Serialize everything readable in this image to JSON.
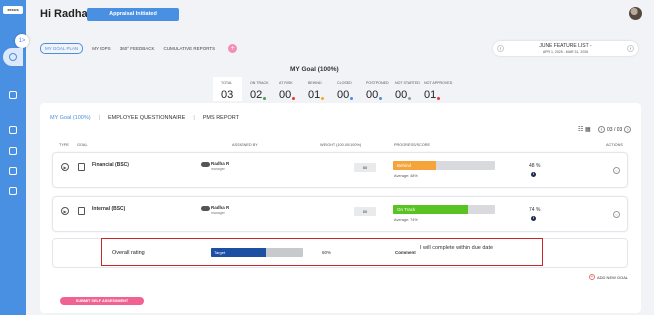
{
  "sidebar": {
    "logo": "xecus",
    "toggle": "1>"
  },
  "header": {
    "greeting": "Hi Radha R",
    "appraisal_button": "Appraisal Initiated"
  },
  "tabs": [
    "MY GOAL PLAN",
    "MY IDPS",
    "360° FEEDBACK",
    "CUMULATIVE REPORTS"
  ],
  "add_label": "+",
  "feature": {
    "title": "JUNE FEATURE LIST -",
    "dates": "APR 1, 2025 - MAR 31, 2026",
    "prev": "‹",
    "next": "›"
  },
  "goal_title": "MY Goal (100%)",
  "stats": [
    {
      "label": "TOTAL",
      "value": "03",
      "dot": ""
    },
    {
      "label": "ON TRACK",
      "value": "02",
      "dot": "#43a047"
    },
    {
      "label": "AT RISK",
      "value": "00",
      "dot": "#e53935"
    },
    {
      "label": "BEHIND",
      "value": "01",
      "dot": "#f9a825"
    },
    {
      "label": "CLOSED",
      "value": "00",
      "dot": "#4a90e2"
    },
    {
      "label": "POSTPONED",
      "value": "00",
      "dot": "#4a90e2"
    },
    {
      "label": "NOT STARTED",
      "value": "00",
      "dot": "#9e9e9e"
    },
    {
      "label": "NOT APPROVED",
      "value": "01",
      "dot": "#e53935"
    }
  ],
  "subtabs": [
    "MY Goal (100%)",
    "EMPLOYEE QUESTIONNAIRE",
    "PMS REPORT"
  ],
  "subtab_separator": "|",
  "view_icons": "☷ ▦",
  "pager": {
    "text": "03 / 03",
    "prev": "‹",
    "next": "›"
  },
  "columns": {
    "type": "TYPE",
    "goal": "GOAL",
    "assigned": "ASSIGNED BY",
    "weight": "WEIGHT (100.00/100%)",
    "progress": "PROGRESS/SCORE",
    "actions": "ACTIONS"
  },
  "goals": [
    {
      "name": "Financial (BSC)",
      "assignee": "Radha R",
      "role": "manager",
      "weight": "50",
      "status": "Behind",
      "status_color": "#f5a43a",
      "progress": 0.42,
      "average": "Average: 48%",
      "percent": "48",
      "percent_unit": "%",
      "info": "i",
      "action": "○"
    },
    {
      "name": "Internal (BSC)",
      "assignee": "Radha R",
      "role": "manager",
      "weight": "50",
      "status": "On Track",
      "status_color": "#58c322",
      "progress": 0.74,
      "average": "Average: 74%",
      "percent": "74",
      "percent_unit": "%",
      "info": "i",
      "action": "○"
    }
  ],
  "play_icon": "▶",
  "overall": {
    "label": "Overall rating",
    "bar_label": "Target",
    "progress": 0.6,
    "percent": "60%",
    "comment_label": "Comment",
    "comment_value": "I will complete within due date"
  },
  "add_goal": {
    "label": "ADD NEW GOAL",
    "icon": "+"
  },
  "submit": "SUBMIT SELF ASSESSMENT"
}
